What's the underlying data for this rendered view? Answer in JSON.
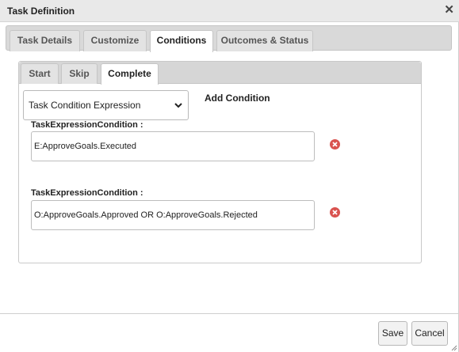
{
  "dialog": {
    "title": "Task Definition",
    "close_icon": "close-icon",
    "outer_tabs": [
      "Task Details",
      "Customize",
      "Conditions",
      "Outcomes & Status"
    ],
    "active_outer_tab": "Conditions",
    "inner_tabs": [
      "Start",
      "Skip",
      "Complete"
    ],
    "active_inner_tab": "Complete"
  },
  "conditions_panel": {
    "select_value": "Task Condition Expression",
    "add_condition_label": "Add Condition",
    "conditions": [
      {
        "label": "TaskExpressionCondition :",
        "value": "E:ApproveGoals.Executed",
        "delete_icon": "remove-circle-icon"
      },
      {
        "label": "TaskExpressionCondition :",
        "value": "O:ApproveGoals.Approved OR O:ApproveGoals.Rejected",
        "delete_icon": "remove-circle-icon"
      }
    ]
  },
  "footer": {
    "save_label": "Save",
    "cancel_label": "Cancel"
  },
  "colors": {
    "delete_icon": "#d9534f",
    "titlebar_bg": "#e9e9e9",
    "tabbar_bg": "#d9d9d9"
  }
}
